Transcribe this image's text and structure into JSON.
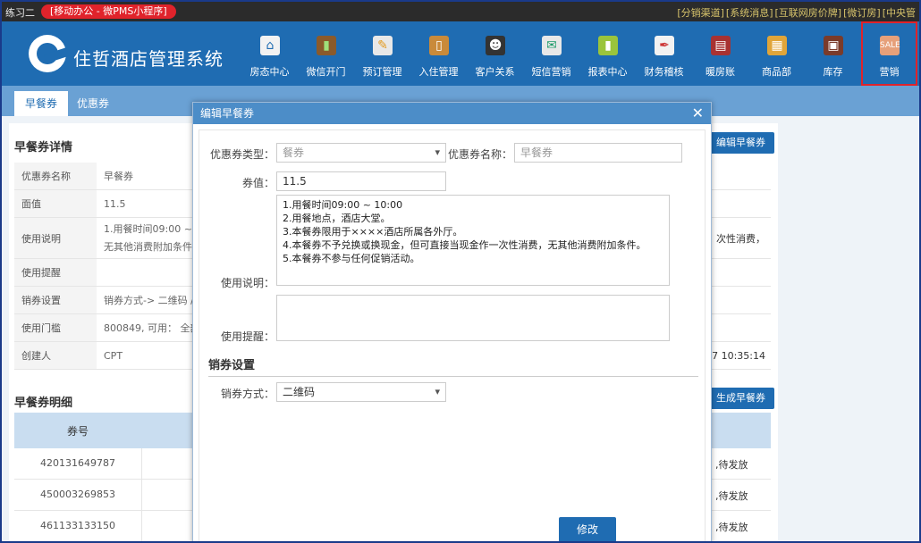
{
  "topbar": {
    "user": "练习二",
    "badge": "[移动办公 - 微PMS小程序]",
    "links": [
      "[分销渠道]",
      "[系统消息]",
      "[互联网房价牌]",
      "[微订房]",
      "[中央管"
    ]
  },
  "header": {
    "brand": "住哲酒店管理系统",
    "nav": [
      {
        "label": "房态中心",
        "icon": "house-icon"
      },
      {
        "label": "微信开门",
        "icon": "wechat-door-icon"
      },
      {
        "label": "预订管理",
        "icon": "edit-icon"
      },
      {
        "label": "入住管理",
        "icon": "door-icon"
      },
      {
        "label": "客户关系",
        "icon": "people-icon"
      },
      {
        "label": "短信营销",
        "icon": "envelope-icon"
      },
      {
        "label": "报表中心",
        "icon": "bar-chart-icon"
      },
      {
        "label": "财务稽核",
        "icon": "pen-icon"
      },
      {
        "label": "暖房账",
        "icon": "book-icon"
      },
      {
        "label": "商品部",
        "icon": "goods-icon"
      },
      {
        "label": "库存",
        "icon": "warehouse-icon"
      },
      {
        "label": "营销",
        "icon": "sale-tag-icon",
        "active": true
      }
    ],
    "active_color": "#e0232b"
  },
  "tabs": [
    "早餐券",
    "优惠券"
  ],
  "detail": {
    "title": "早餐券详情",
    "edit_button": "编辑早餐券",
    "rows": [
      {
        "key": "优惠券名称",
        "value": "早餐券"
      },
      {
        "key": "面值",
        "value": "11.5"
      },
      {
        "key": "使用说明",
        "value": "1.用餐时间09:00 ~ 1",
        "value2": "无其他消费附加条件",
        "tail": "次性消费，"
      },
      {
        "key": "使用提醒",
        "value": ""
      },
      {
        "key": "销券设置",
        "value": "销券方式-> 二维码 /"
      },
      {
        "key": "使用门槛",
        "value": "800849, 可用： 全部"
      },
      {
        "key": "创建人",
        "value": "CPT",
        "tail": "7 10:35:14"
      }
    ]
  },
  "list": {
    "title": "早餐券明细",
    "gen_button": "生成早餐券",
    "col_header": "券号",
    "rows": [
      {
        "number": "420131649787",
        "status": ",待发放"
      },
      {
        "number": "450003269853",
        "status": ",待发放"
      },
      {
        "number": "461133133150",
        "status": ",待发放"
      }
    ]
  },
  "modal": {
    "title": "编辑早餐券",
    "close": "✕",
    "type_label": "优惠券类型：",
    "type_value": "餐券",
    "name_label": "优惠券名称：",
    "name_placeholder": "早餐券",
    "value_label": "券值：",
    "value_value": "11.5",
    "desc_label": "使用说明：",
    "desc_text": "1.用餐时间09:00 ~ 10:00\n2.用餐地点，酒店大堂。\n3.本餐券限用于××××酒店所属各外厅。\n4.本餐券不予兑换或换现金，但可直接当现金作一次性消费，无其他消费附加条件。\n5.本餐券不参与任何促销活动。",
    "remind_label": "使用提醒：",
    "remind_text": "",
    "section": "销券设置",
    "method_label": "销券方式：",
    "method_value": "二维码",
    "save": "修改"
  }
}
